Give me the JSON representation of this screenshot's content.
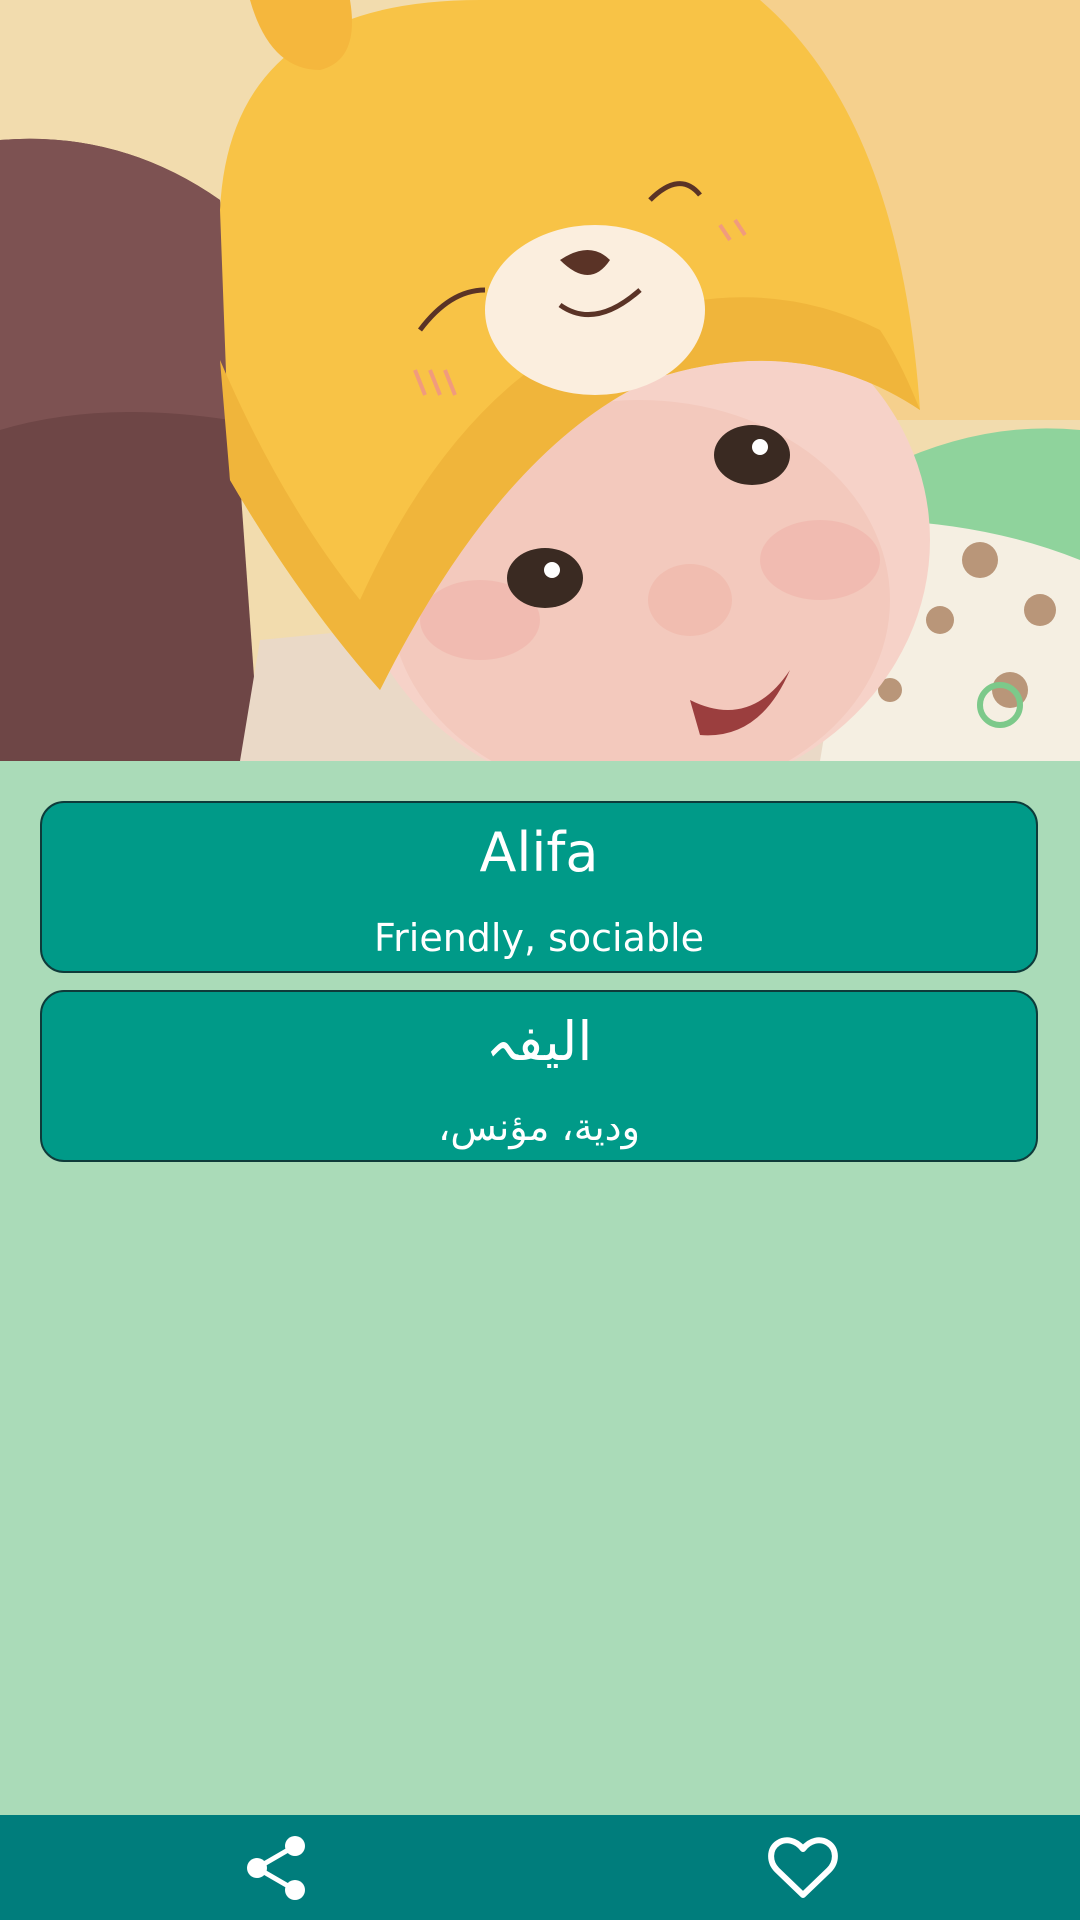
{
  "hero": {
    "image_description_icon": "baby-photo"
  },
  "name_english": {
    "name": "Alifa",
    "meaning": "Friendly, sociable"
  },
  "name_arabic": {
    "name": "اليفہ",
    "meaning": "ودية، مؤنس،"
  },
  "bottom_bar": {
    "share_icon": "share-icon",
    "favorite_icon": "heart-outline-icon",
    "background": "#007d7c"
  },
  "colors": {
    "page_background": "#aadbb8",
    "card_background": "#009a88",
    "card_border": "#0e3b3a",
    "text": "#ffffff"
  }
}
